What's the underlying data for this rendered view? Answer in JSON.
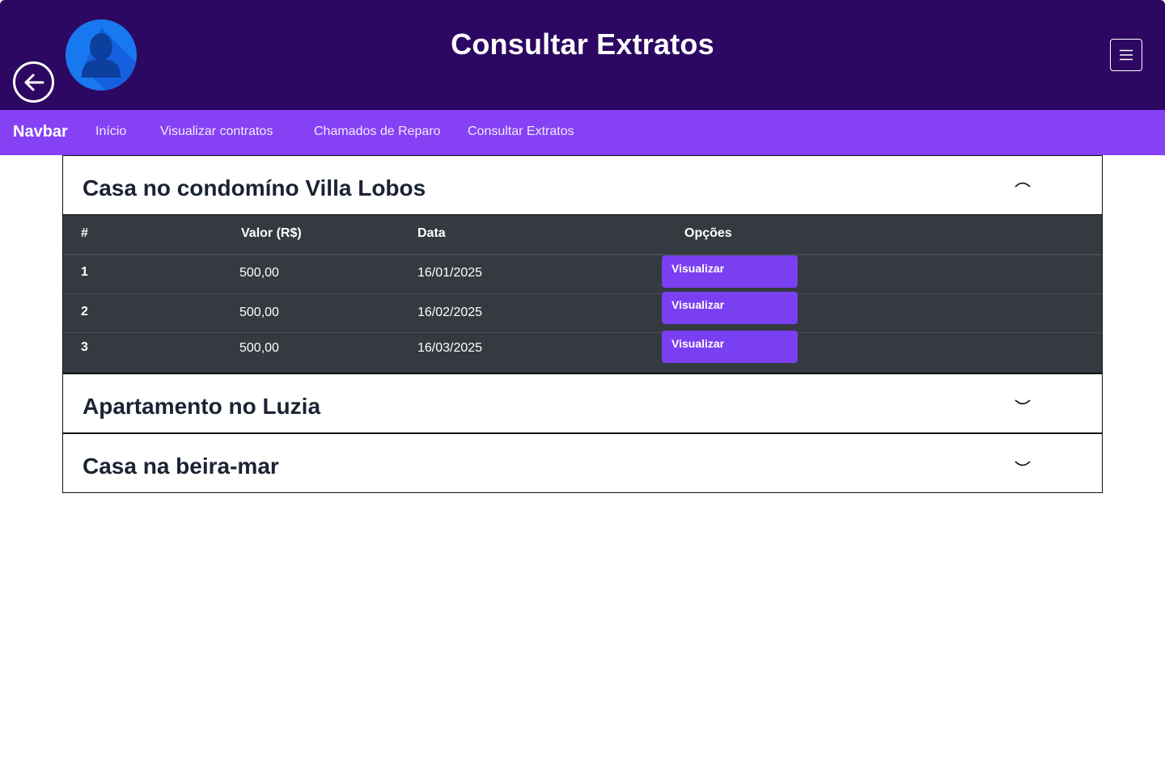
{
  "header": {
    "title": "Consultar Extratos",
    "back_icon": "arrow-left-circle-icon",
    "avatar_icon": "user-silhouette-icon",
    "menu_icon": "hamburger-menu-icon",
    "bg_color": "#2c0862"
  },
  "navbar": {
    "brand": "Navbar",
    "links": [
      "Início",
      "Visualizar contratos",
      "Chamados de Reparo",
      "Consultar Extratos"
    ],
    "bg_color": "#8641f4"
  },
  "accordion": [
    {
      "title": "Casa no condomíno Villa Lobos",
      "expanded": true,
      "chevron_icon": "chevron-up-icon",
      "table": {
        "columns": [
          "#",
          "Valor (R$)",
          "Data",
          "Opções"
        ],
        "rows": [
          {
            "n": "1",
            "valor": "500,00",
            "data": "16/01/2025",
            "action": "Visualizar"
          },
          {
            "n": "2",
            "valor": "500,00",
            "data": "16/02/2025",
            "action": "Visualizar"
          },
          {
            "n": "3",
            "valor": "500,00",
            "data": "16/03/2025",
            "action": "Visualizar"
          }
        ]
      }
    },
    {
      "title": "Apartamento no Luzia",
      "expanded": false,
      "chevron_icon": "chevron-down-icon"
    },
    {
      "title": "Casa na beira-mar",
      "expanded": false,
      "chevron_icon": "chevron-down-icon"
    }
  ],
  "colors": {
    "accent": "#7b3ff2",
    "table_bg": "#343a40"
  }
}
